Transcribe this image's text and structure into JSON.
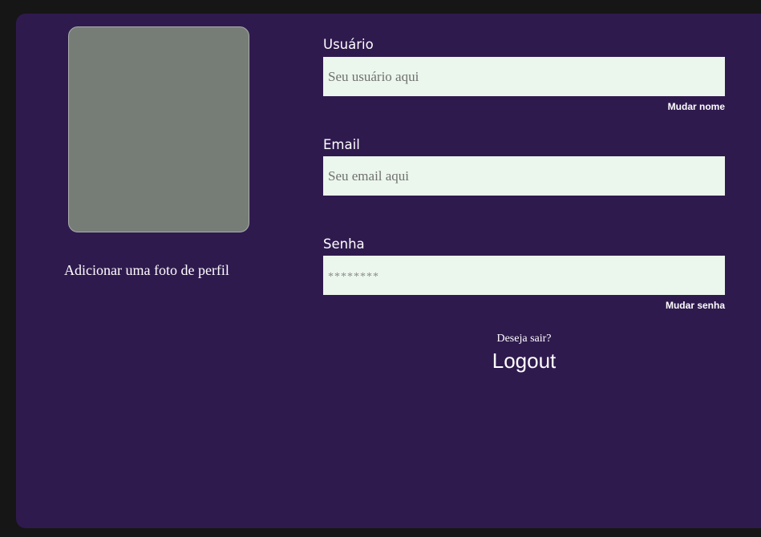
{
  "profile": {
    "photo_caption": "Adicionar uma foto de perfil"
  },
  "form": {
    "username": {
      "label": "Usuário",
      "placeholder": "Seu usuário aqui",
      "action_label": "Mudar nome"
    },
    "email": {
      "label": "Email",
      "placeholder": "Seu email aqui"
    },
    "password": {
      "label": "Senha",
      "placeholder": "********",
      "action_label": "Mudar senha"
    }
  },
  "logout": {
    "question": "Deseja sair?",
    "button_label": "Logout"
  },
  "colors": {
    "background": "#161616",
    "panel": "#2f1a4e",
    "input_background": "#ebf6ec",
    "photo_placeholder": "#767d77",
    "text": "#ffffff"
  }
}
